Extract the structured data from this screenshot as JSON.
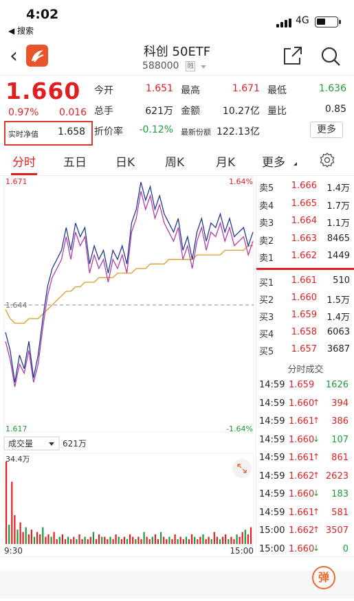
{
  "status_bar": {
    "time": "4:02",
    "back_app": "◀ 搜索",
    "network": "4G"
  },
  "header": {
    "title": "科创 50ETF",
    "code": "588000",
    "badge": "融"
  },
  "quote": {
    "price": "1.660",
    "change_pct": "0.97%",
    "change": "0.016",
    "nav_label": "实时净值",
    "nav_value": "1.658",
    "fields": [
      {
        "label": "今开",
        "value": "1.651",
        "color": "#e02020"
      },
      {
        "label": "最高",
        "value": "1.671",
        "color": "#e02020"
      },
      {
        "label": "最低",
        "value": "1.636",
        "color": "#1a9a3a"
      },
      {
        "label": "总手",
        "value": "621万",
        "color": "#222222"
      },
      {
        "label": "金额",
        "value": "10.27亿",
        "color": "#222222"
      },
      {
        "label": "量比",
        "value": "0.85",
        "color": "#222222"
      },
      {
        "label": "折价率",
        "value": "-0.12%",
        "color": "#1a9a3a"
      },
      {
        "label": "最新份额",
        "value": "122.13亿",
        "color": "#222222"
      }
    ],
    "more_button": "更多"
  },
  "tabs": [
    "分时",
    "五日",
    "日K",
    "周K",
    "月K",
    "更多"
  ],
  "active_tab": "分时",
  "chart_data": {
    "type": "line",
    "title": "",
    "y_high_label": "1.671",
    "y_low_label": "1.617",
    "pct_high_label": "1.64%",
    "pct_low_label": "-1.64%",
    "prev_close_label": "1.644",
    "prev_close": 1.644,
    "ylim": [
      1.617,
      1.671
    ],
    "x_start_label": "9:30",
    "x_end_label": "15:00",
    "series": [
      {
        "color": "#1f3a8a",
        "values": [
          1.638,
          1.634,
          1.627,
          1.633,
          1.63,
          1.636,
          1.628,
          1.633,
          1.641,
          1.648,
          1.652,
          1.654,
          1.656,
          1.661,
          1.656,
          1.662,
          1.659,
          1.661,
          1.653,
          1.657,
          1.654,
          1.656,
          1.651,
          1.656,
          1.654,
          1.657,
          1.653,
          1.662,
          1.665,
          1.671,
          1.667,
          1.67,
          1.665,
          1.668,
          1.664,
          1.662,
          1.66,
          1.663,
          1.656,
          1.659,
          1.654,
          1.66,
          1.663,
          1.658,
          1.662,
          1.661,
          1.664,
          1.66,
          1.663,
          1.659,
          1.66,
          1.661,
          1.657,
          1.66
        ]
      },
      {
        "color": "#b03ab0",
        "values": [
          1.636,
          1.632,
          1.626,
          1.631,
          1.629,
          1.634,
          1.627,
          1.631,
          1.639,
          1.646,
          1.65,
          1.652,
          1.654,
          1.659,
          1.654,
          1.66,
          1.657,
          1.659,
          1.651,
          1.655,
          1.652,
          1.654,
          1.649,
          1.654,
          1.652,
          1.655,
          1.651,
          1.66,
          1.663,
          1.669,
          1.665,
          1.668,
          1.663,
          1.666,
          1.662,
          1.66,
          1.658,
          1.661,
          1.654,
          1.657,
          1.652,
          1.658,
          1.661,
          1.656,
          1.66,
          1.659,
          1.662,
          1.658,
          1.661,
          1.657,
          1.658,
          1.659,
          1.655,
          1.658
        ]
      },
      {
        "color": "#e09a20",
        "values": [
          1.643,
          1.641,
          1.64,
          1.64,
          1.64,
          1.641,
          1.641,
          1.641,
          1.642,
          1.643,
          1.644,
          1.645,
          1.646,
          1.647,
          1.647,
          1.648,
          1.648,
          1.649,
          1.649,
          1.649,
          1.65,
          1.65,
          1.65,
          1.65,
          1.651,
          1.651,
          1.651,
          1.651,
          1.652,
          1.652,
          1.652,
          1.653,
          1.653,
          1.653,
          1.653,
          1.654,
          1.654,
          1.654,
          1.654,
          1.654,
          1.654,
          1.655,
          1.655,
          1.655,
          1.655,
          1.655,
          1.655,
          1.656,
          1.656,
          1.656,
          1.656,
          1.656,
          1.657,
          1.657
        ]
      }
    ],
    "volume": {
      "selector_label": "成交量",
      "total_label": "621万",
      "max_label": "34.4万",
      "bars": [
        34.4,
        8,
        26,
        12,
        6,
        9,
        5,
        7,
        4,
        6,
        3,
        5,
        4,
        7,
        3,
        4,
        3,
        5,
        2,
        3,
        4,
        2,
        3,
        2,
        3,
        2,
        4,
        2,
        3,
        2,
        3,
        5,
        2,
        4,
        3,
        3,
        2,
        3,
        2,
        4,
        3,
        2,
        3,
        2,
        4,
        3,
        2,
        3,
        2,
        5,
        3,
        2,
        3,
        4,
        2,
        5,
        3,
        2,
        3,
        2,
        4,
        2,
        3,
        2,
        3,
        2,
        4,
        3,
        2,
        3,
        4,
        2,
        3,
        2,
        5,
        3,
        2,
        3,
        4,
        2,
        3,
        2,
        4,
        3,
        5,
        6,
        4,
        7
      ],
      "up_color": "#e02020",
      "down_color": "#1a9a3a"
    }
  },
  "order_book": {
    "asks": [
      {
        "label": "卖5",
        "price": "1.666",
        "volume": "1.4万"
      },
      {
        "label": "卖4",
        "price": "1.665",
        "volume": "1.7万"
      },
      {
        "label": "卖3",
        "price": "1.664",
        "volume": "1.1万"
      },
      {
        "label": "卖2",
        "price": "1.663",
        "volume": "8465"
      },
      {
        "label": "卖1",
        "price": "1.662",
        "volume": "1449"
      }
    ],
    "bids": [
      {
        "label": "买1",
        "price": "1.661",
        "volume": "510"
      },
      {
        "label": "买2",
        "price": "1.660",
        "volume": "1.5万"
      },
      {
        "label": "买3",
        "price": "1.659",
        "volume": "1.4万"
      },
      {
        "label": "买4",
        "price": "1.658",
        "volume": "6063"
      },
      {
        "label": "买5",
        "price": "1.657",
        "volume": "3687"
      }
    ]
  },
  "ticks": {
    "title": "分时成交",
    "rows": [
      {
        "time": "14:59",
        "price": "1.659",
        "arrow": "",
        "volume": "1626",
        "color": "#1a9a3a"
      },
      {
        "time": "14:59",
        "price": "1.660",
        "arrow": "↑",
        "volume": "394",
        "color": "#e02020"
      },
      {
        "time": "14:59",
        "price": "1.661",
        "arrow": "↑",
        "volume": "386",
        "color": "#e02020"
      },
      {
        "time": "14:59",
        "price": "1.660",
        "arrow": "↓",
        "volume": "107",
        "color": "#1a9a3a"
      },
      {
        "time": "14:59",
        "price": "1.661",
        "arrow": "↑",
        "volume": "861",
        "color": "#e02020"
      },
      {
        "time": "14:59",
        "price": "1.662",
        "arrow": "↑",
        "volume": "2623",
        "color": "#e02020"
      },
      {
        "time": "14:59",
        "price": "1.660",
        "arrow": "↓",
        "volume": "183",
        "color": "#1a9a3a"
      },
      {
        "time": "14:59",
        "price": "1.661",
        "arrow": "↑",
        "volume": "581",
        "color": "#e02020"
      },
      {
        "time": "15:00",
        "price": "1.662",
        "arrow": "↑",
        "volume": "3507",
        "color": "#e02020"
      },
      {
        "time": "15:00",
        "price": "1.660",
        "arrow": "↓",
        "volume": "0",
        "color": "#1a9a3a"
      }
    ]
  },
  "bottom": {
    "danmu_label": "弹"
  }
}
